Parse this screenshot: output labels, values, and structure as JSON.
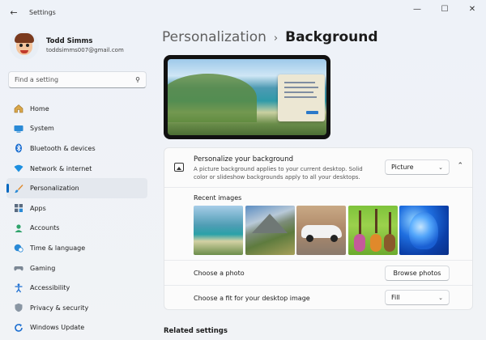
{
  "app": {
    "title": "Settings",
    "back_icon": "back-arrow-icon"
  },
  "window_controls": {
    "minimize": "—",
    "maximize": "☐",
    "close": "✕"
  },
  "profile": {
    "name": "Todd Simms",
    "email": "toddsimms007@gmail.com"
  },
  "search": {
    "placeholder": "Find a setting"
  },
  "nav": {
    "items": [
      {
        "label": "Home",
        "icon": "home-icon"
      },
      {
        "label": "System",
        "icon": "system-icon"
      },
      {
        "label": "Bluetooth & devices",
        "icon": "bluetooth-icon"
      },
      {
        "label": "Network & internet",
        "icon": "wifi-icon"
      },
      {
        "label": "Personalization",
        "icon": "brush-icon",
        "active": true
      },
      {
        "label": "Apps",
        "icon": "apps-icon"
      },
      {
        "label": "Accounts",
        "icon": "accounts-icon"
      },
      {
        "label": "Time & language",
        "icon": "globe-clock-icon"
      },
      {
        "label": "Gaming",
        "icon": "gamepad-icon"
      },
      {
        "label": "Accessibility",
        "icon": "accessibility-icon"
      },
      {
        "label": "Privacy & security",
        "icon": "shield-icon"
      },
      {
        "label": "Windows Update",
        "icon": "update-icon"
      }
    ]
  },
  "breadcrumb": {
    "parent": "Personalization",
    "separator": "›",
    "current": "Background"
  },
  "background": {
    "title": "Personalize your background",
    "description": "A picture background applies to your current desktop. Solid color or slideshow backgrounds apply to all your desktops.",
    "type_value": "Picture",
    "recent_images_label": "Recent images",
    "recent_images": [
      "beach-bay-image",
      "mountain-valley-image",
      "white-sports-car-image",
      "guitars-image",
      "blue-bloom-image"
    ],
    "choose_photo_label": "Choose a photo",
    "browse_label": "Browse photos",
    "fit_label": "Choose a fit for your desktop image",
    "fit_value": "Fill"
  },
  "related": {
    "heading": "Related settings"
  },
  "colors": {
    "accent": "#0067c0",
    "sidebar_bg": "#eef2f8",
    "card_bg": "#fbfbfb"
  }
}
